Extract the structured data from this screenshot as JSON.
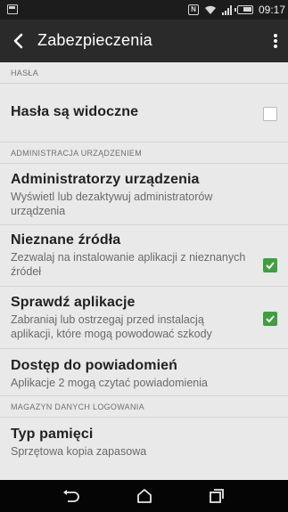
{
  "status_bar": {
    "time": "09:17",
    "nfc_label": "N"
  },
  "app_bar": {
    "title": "Zabezpieczenia"
  },
  "sections": {
    "hasla": {
      "header": "HASŁA",
      "items": [
        {
          "title": "Hasła są widoczne",
          "checked": false
        }
      ]
    },
    "admin": {
      "header": "ADMINISTRACJA URZĄDZENIEM",
      "items": [
        {
          "title": "Administratorzy urządzenia",
          "subtitle": "Wyświetl lub dezaktywuj administratorów urządzenia"
        },
        {
          "title": "Nieznane źródła",
          "subtitle": "Zezwalaj na instalowanie aplikacji z nieznanych źródeł",
          "checked": true
        },
        {
          "title": "Sprawdź aplikacje",
          "subtitle": "Zabraniaj lub ostrzegaj przed instalacją aplikacji, które mogą powodować szkody",
          "checked": true
        },
        {
          "title": "Dostęp do powiadomień",
          "subtitle": "Aplikacje 2 mogą czytać powiadomienia"
        }
      ]
    },
    "storage": {
      "header": "MAGAZYN DANYCH LOGOWANIA",
      "items": [
        {
          "title": "Typ pamięci",
          "subtitle": "Sprzętowa kopia zapasowa"
        }
      ]
    }
  },
  "icons": {
    "back": "chevron-left-icon",
    "overflow": "more-vertical-icon",
    "nav_back": "back-arrow-icon",
    "nav_home": "home-icon",
    "nav_recents": "recents-icon"
  },
  "colors": {
    "accent_check": "#3f9f3f",
    "app_bar": "#2a2a2a",
    "background": "#e9e9e9"
  }
}
